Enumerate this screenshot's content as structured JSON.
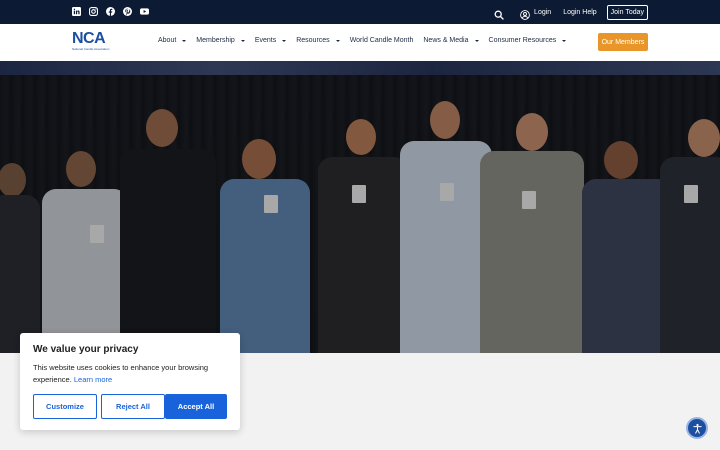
{
  "topbar": {
    "social": [
      "linkedin-icon",
      "instagram-icon",
      "facebook-icon",
      "pinterest-icon",
      "youtube-icon"
    ],
    "login_label": "Login",
    "login_help_label": "Login Help",
    "join_label": "Join Today"
  },
  "navbar": {
    "logo_mark": "NCA",
    "logo_sub": "National Candle Association",
    "items": [
      {
        "label": "About",
        "has_caret": true
      },
      {
        "label": "Membership",
        "has_caret": true
      },
      {
        "label": "Events",
        "has_caret": true
      },
      {
        "label": "Resources",
        "has_caret": true
      },
      {
        "label": "World Candle Month",
        "has_caret": false
      },
      {
        "label": "News & Media",
        "has_caret": true
      },
      {
        "label": "Consumer Resources",
        "has_caret": true
      }
    ],
    "members_button": "Our Members"
  },
  "cookie": {
    "title": "We value your privacy",
    "text": "This website uses cookies to enhance your browsing experience.",
    "learn_more": "Learn more",
    "customize": "Customize",
    "reject": "Reject All",
    "accept": "Accept All"
  },
  "colors": {
    "topbar": "#0d1a33",
    "brand_blue": "#1d4fa0",
    "accent_orange": "#e8962a",
    "cookie_blue": "#1863dc"
  }
}
